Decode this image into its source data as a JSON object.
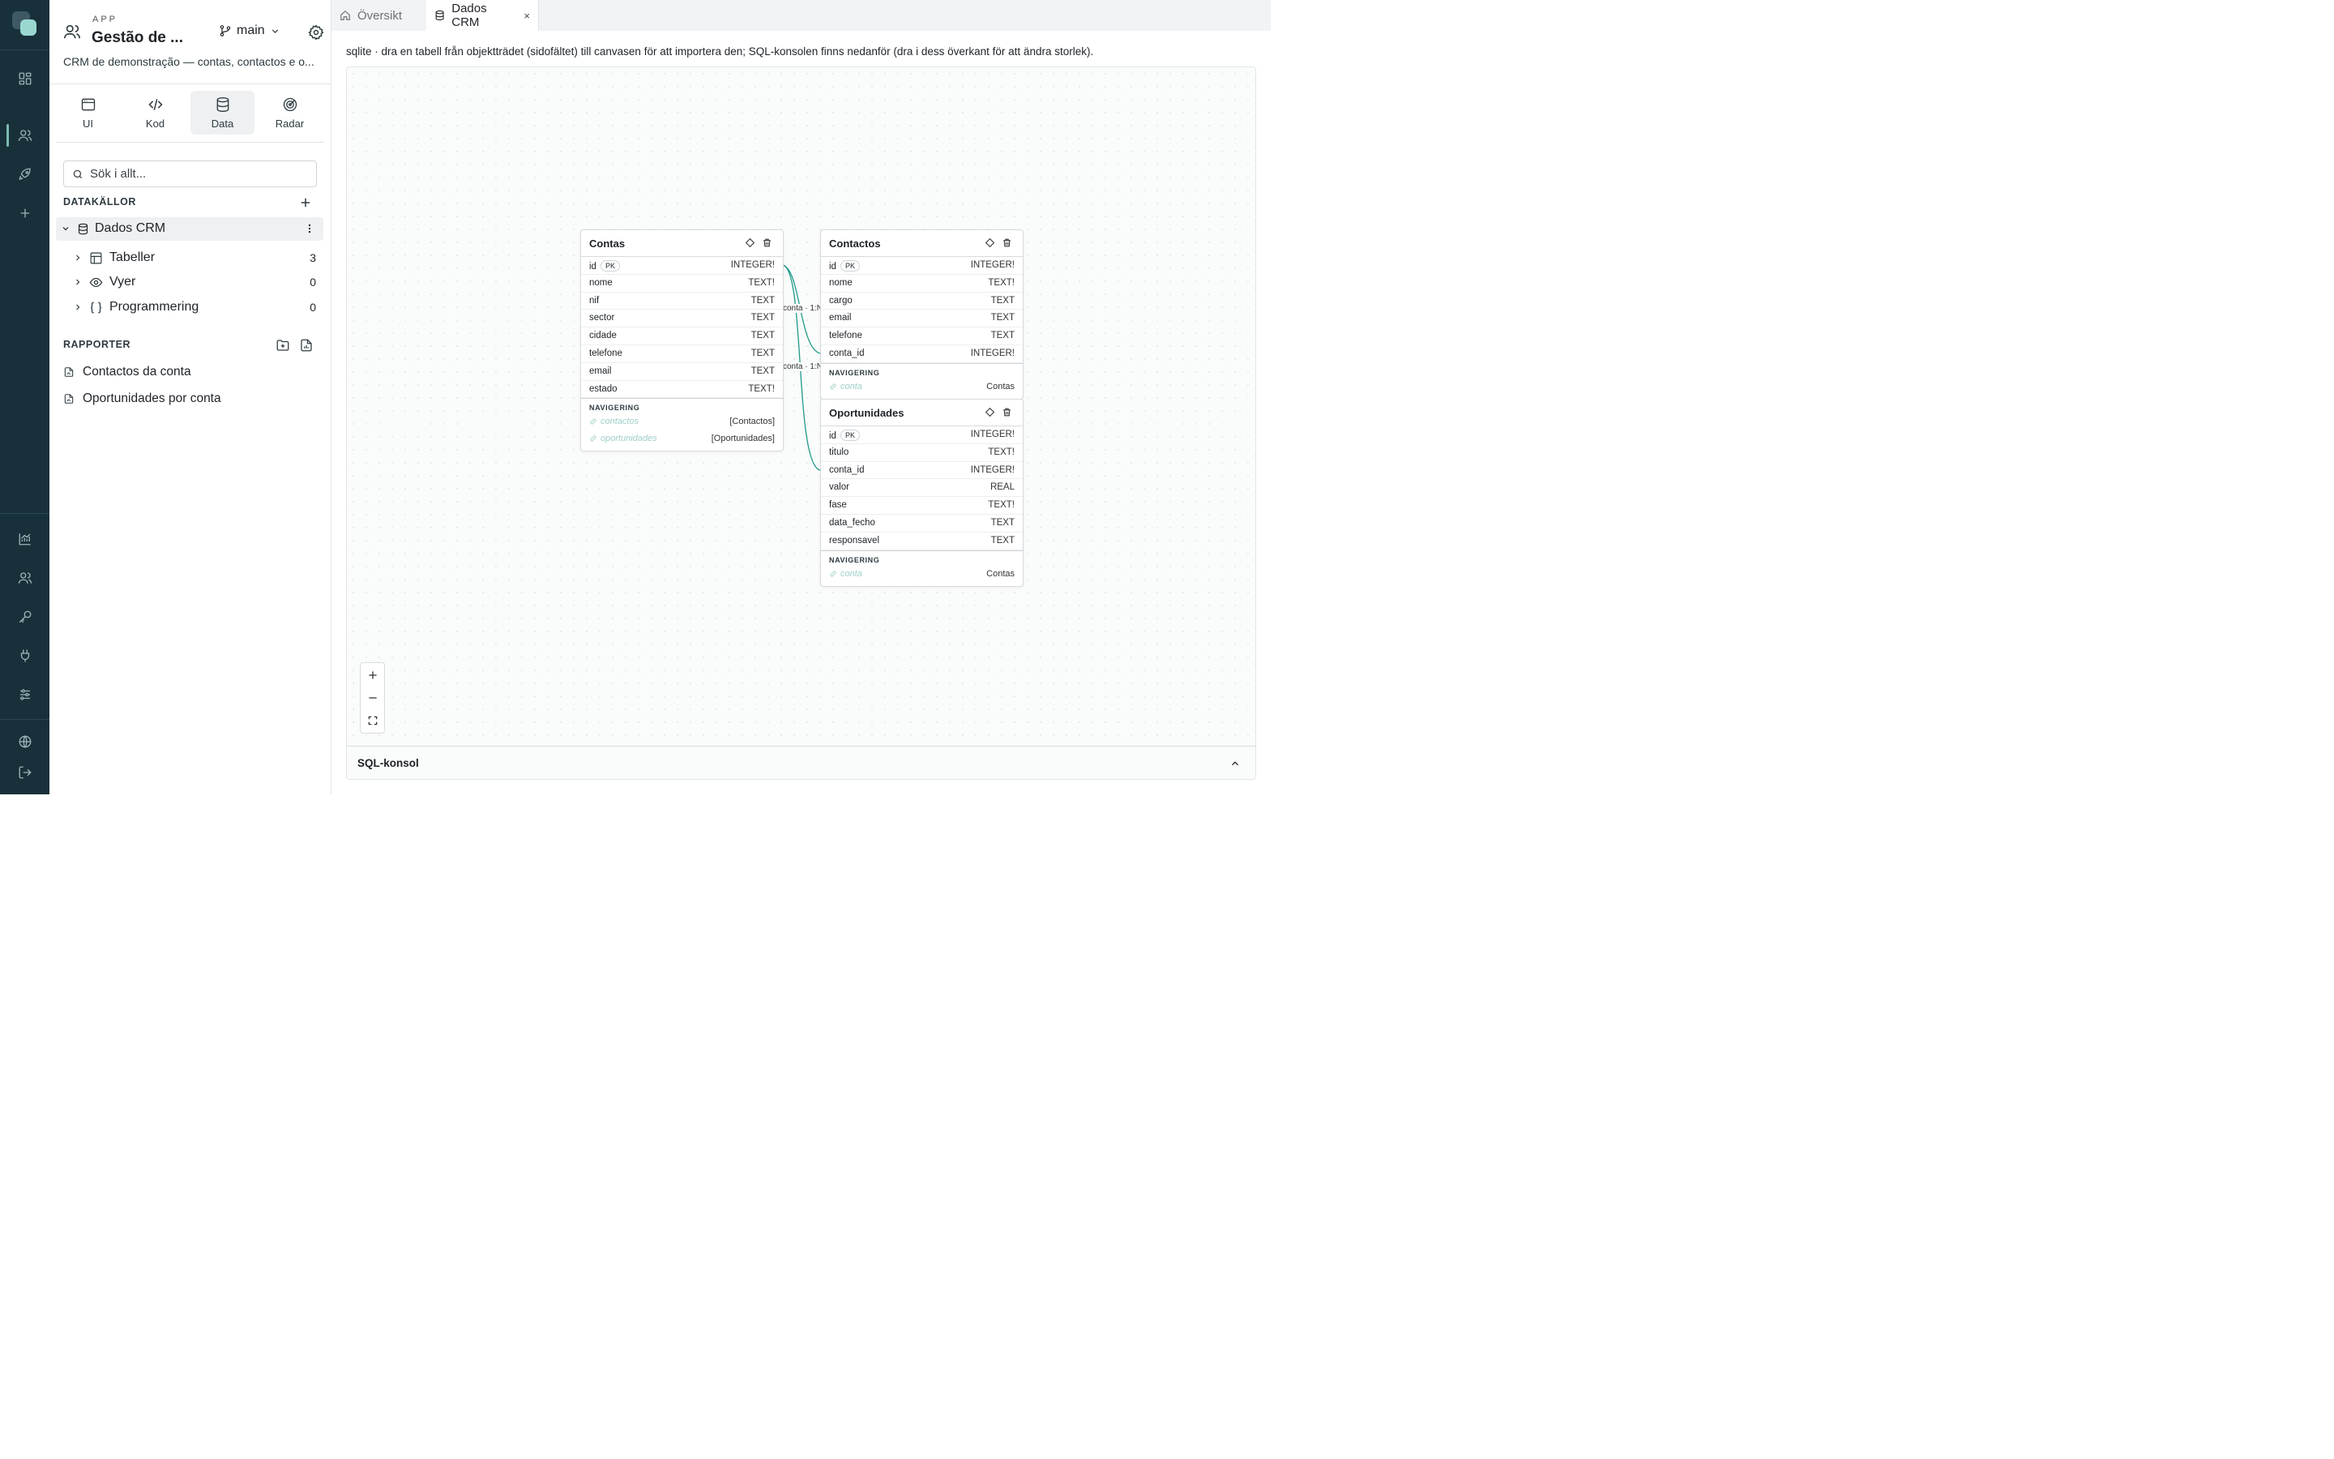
{
  "app": {
    "label": "APP",
    "name": "Gestão de ...",
    "description": "CRM de demonstração — contas, contactos e o...",
    "branch": "main"
  },
  "mode_tabs": [
    {
      "label": "UI",
      "icon": "window-icon"
    },
    {
      "label": "Kod",
      "icon": "code-icon"
    },
    {
      "label": "Data",
      "icon": "database-icon",
      "active": true
    },
    {
      "label": "Radar",
      "icon": "radar-icon"
    }
  ],
  "search": {
    "placeholder": "Sök i allt..."
  },
  "datasources": {
    "heading": "DATAKÄLLOR",
    "source": "Dados CRM",
    "items": [
      {
        "label": "Tabeller",
        "count": "3",
        "icon": "table-icon"
      },
      {
        "label": "Vyer",
        "count": "0",
        "icon": "eye-icon"
      },
      {
        "label": "Programmering",
        "count": "0",
        "icon": "braces-icon"
      }
    ]
  },
  "reports": {
    "heading": "RAPPORTER",
    "items": [
      "Contactos da conta",
      "Oportunidades por conta"
    ]
  },
  "tabs": [
    {
      "label": "Översikt",
      "icon": "home-icon",
      "active": false
    },
    {
      "label": "Dados CRM",
      "icon": "database-icon",
      "active": true,
      "close": "×"
    }
  ],
  "hint": "sqlite · dra en tabell från objektträdet (sidofältet) till canvasen för att importera den; SQL-konsolen finns nedanför (dra i dess överkant för att ändra storlek).",
  "entities": {
    "contas": {
      "title": "Contas",
      "fields": [
        {
          "name": "id",
          "type": "INTEGER!",
          "pk": "PK"
        },
        {
          "name": "nome",
          "type": "TEXT!"
        },
        {
          "name": "nif",
          "type": "TEXT"
        },
        {
          "name": "sector",
          "type": "TEXT"
        },
        {
          "name": "cidade",
          "type": "TEXT"
        },
        {
          "name": "telefone",
          "type": "TEXT"
        },
        {
          "name": "email",
          "type": "TEXT"
        },
        {
          "name": "estado",
          "type": "TEXT!"
        }
      ],
      "nav_heading": "NAVIGERING",
      "nav": [
        {
          "name": "contactos",
          "target": "[Contactos]"
        },
        {
          "name": "oportunidades",
          "target": "[Oportunidades]"
        }
      ]
    },
    "contactos": {
      "title": "Contactos",
      "fields": [
        {
          "name": "id",
          "type": "INTEGER!",
          "pk": "PK"
        },
        {
          "name": "nome",
          "type": "TEXT!"
        },
        {
          "name": "cargo",
          "type": "TEXT"
        },
        {
          "name": "email",
          "type": "TEXT"
        },
        {
          "name": "telefone",
          "type": "TEXT"
        },
        {
          "name": "conta_id",
          "type": "INTEGER!"
        }
      ],
      "nav_heading": "NAVIGERING",
      "nav": [
        {
          "name": "conta",
          "target": "Contas"
        }
      ]
    },
    "oportunidades": {
      "title": "Oportunidades",
      "fields": [
        {
          "name": "id",
          "type": "INTEGER!",
          "pk": "PK"
        },
        {
          "name": "titulo",
          "type": "TEXT!"
        },
        {
          "name": "conta_id",
          "type": "INTEGER!"
        },
        {
          "name": "valor",
          "type": "REAL"
        },
        {
          "name": "fase",
          "type": "TEXT!"
        },
        {
          "name": "data_fecho",
          "type": "TEXT"
        },
        {
          "name": "responsavel",
          "type": "TEXT"
        }
      ],
      "nav_heading": "NAVIGERING",
      "nav": [
        {
          "name": "conta",
          "target": "Contas"
        }
      ]
    }
  },
  "relations": [
    {
      "label": "conta · 1:N"
    },
    {
      "label": "conta · 1:N"
    }
  ],
  "sql_console": {
    "label": "SQL-konsol"
  },
  "colors": {
    "rail": "#17303a",
    "accent": "#1f9a8a",
    "canvas": "#fafbfb"
  }
}
